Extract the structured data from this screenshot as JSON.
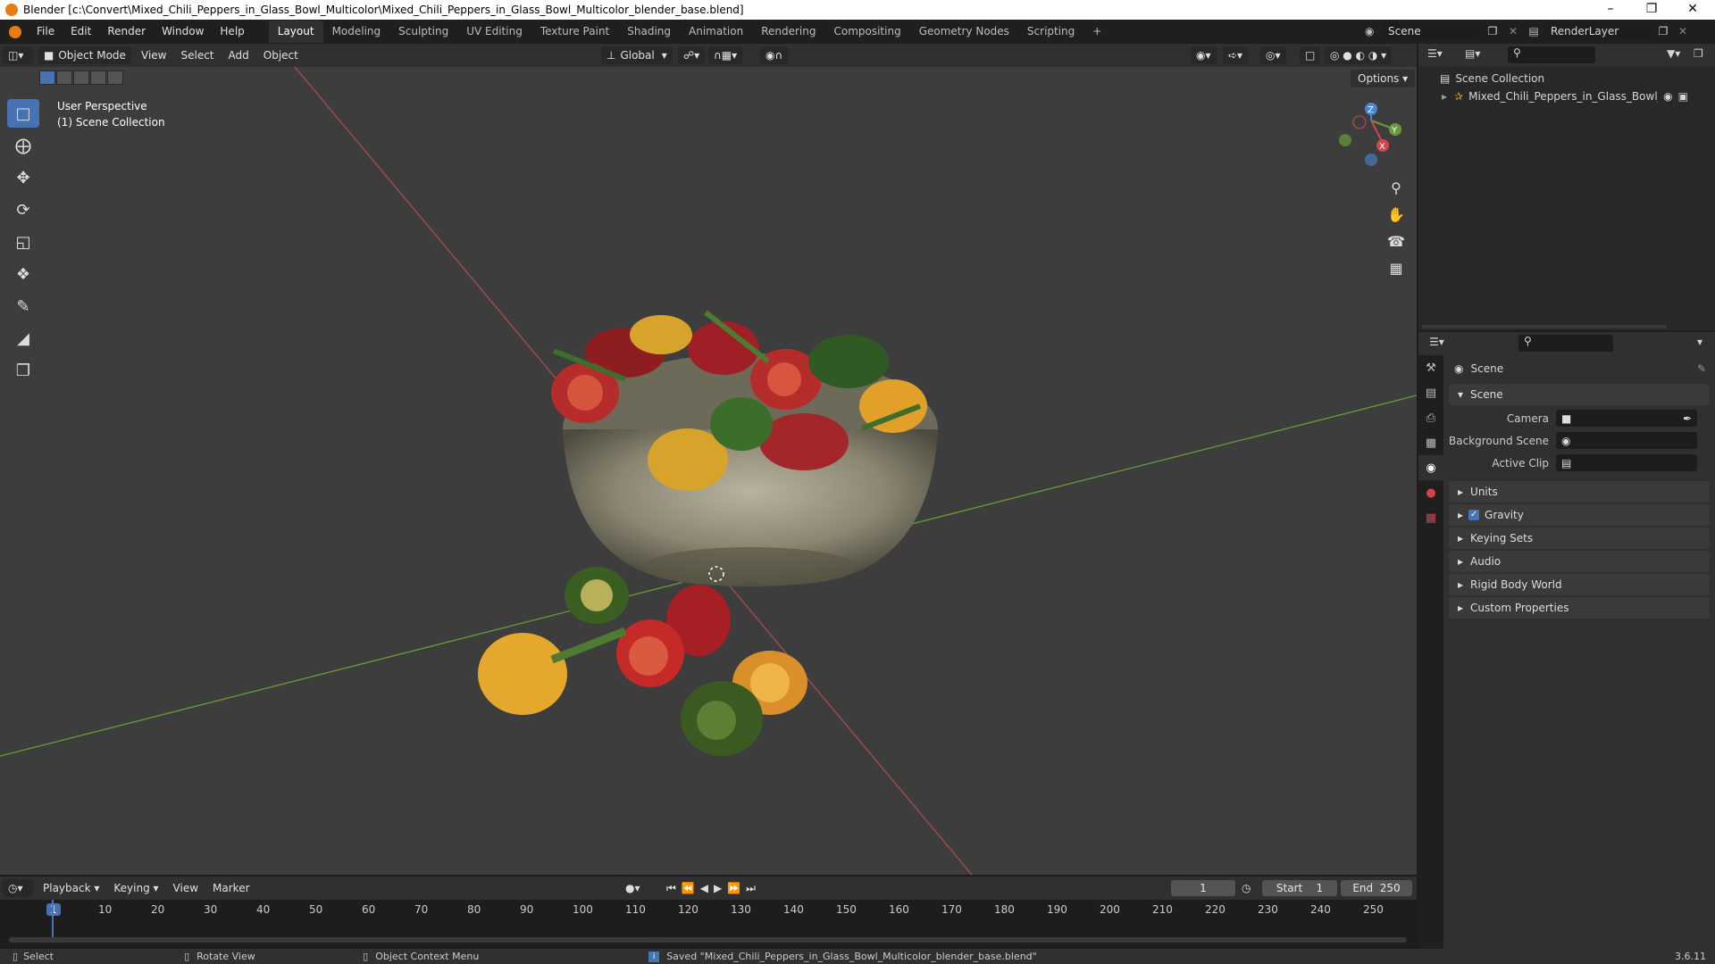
{
  "window": {
    "title": "Blender [c:\\Convert\\Mixed_Chili_Peppers_in_Glass_Bowl_Multicolor\\Mixed_Chili_Peppers_in_Glass_Bowl_Multicolor_blender_base.blend]"
  },
  "topbar": {
    "menus": [
      "File",
      "Edit",
      "Render",
      "Window",
      "Help"
    ],
    "workspaces": [
      "Layout",
      "Modeling",
      "Sculpting",
      "UV Editing",
      "Texture Paint",
      "Shading",
      "Animation",
      "Rendering",
      "Compositing",
      "Geometry Nodes",
      "Scripting"
    ],
    "active_workspace": "Layout",
    "add_tab": "+",
    "scene": "Scene",
    "render_layer": "RenderLayer"
  },
  "viewport_header": {
    "mode": "Object Mode",
    "menus": [
      "View",
      "Select",
      "Add",
      "Object"
    ],
    "orientation": "Global",
    "options": "Options"
  },
  "viewport": {
    "perspective": "User Perspective",
    "collection": "(1) Scene Collection",
    "gizmo": {
      "x": "X",
      "y": "Y",
      "z": "Z"
    }
  },
  "outliner": {
    "root": "Scene Collection",
    "items": [
      "Mixed_Chili_Peppers_in_Glass_Bowl_Mu"
    ]
  },
  "properties": {
    "context": "Scene",
    "panel_title": "Scene",
    "fields": [
      {
        "label": "Camera",
        "value": ""
      },
      {
        "label": "Background Scene",
        "value": ""
      },
      {
        "label": "Active Clip",
        "value": ""
      }
    ],
    "panels": [
      "Units",
      "Gravity",
      "Keying Sets",
      "Audio",
      "Rigid Body World",
      "Custom Properties"
    ],
    "gravity_checked": true
  },
  "timeline": {
    "menus": [
      "Playback",
      "Keying",
      "View",
      "Marker"
    ],
    "current_frame": "1",
    "start_label": "Start",
    "start": "1",
    "end_label": "End",
    "end": "250",
    "ticks": [
      "1",
      "10",
      "20",
      "30",
      "40",
      "50",
      "60",
      "70",
      "80",
      "90",
      "100",
      "110",
      "120",
      "130",
      "140",
      "150",
      "160",
      "170",
      "180",
      "190",
      "200",
      "210",
      "220",
      "230",
      "240",
      "250"
    ]
  },
  "statusbar": {
    "select": "Select",
    "rotate": "Rotate View",
    "context_menu": "Object Context Menu",
    "message": "Saved \"Mixed_Chili_Peppers_in_Glass_Bowl_Multicolor_blender_base.blend\"",
    "version": "3.6.11"
  },
  "colors": {
    "accent": "#4772b3",
    "x_axis": "#d4444a",
    "y_axis": "#88b04a",
    "z_axis": "#4a85d4"
  }
}
